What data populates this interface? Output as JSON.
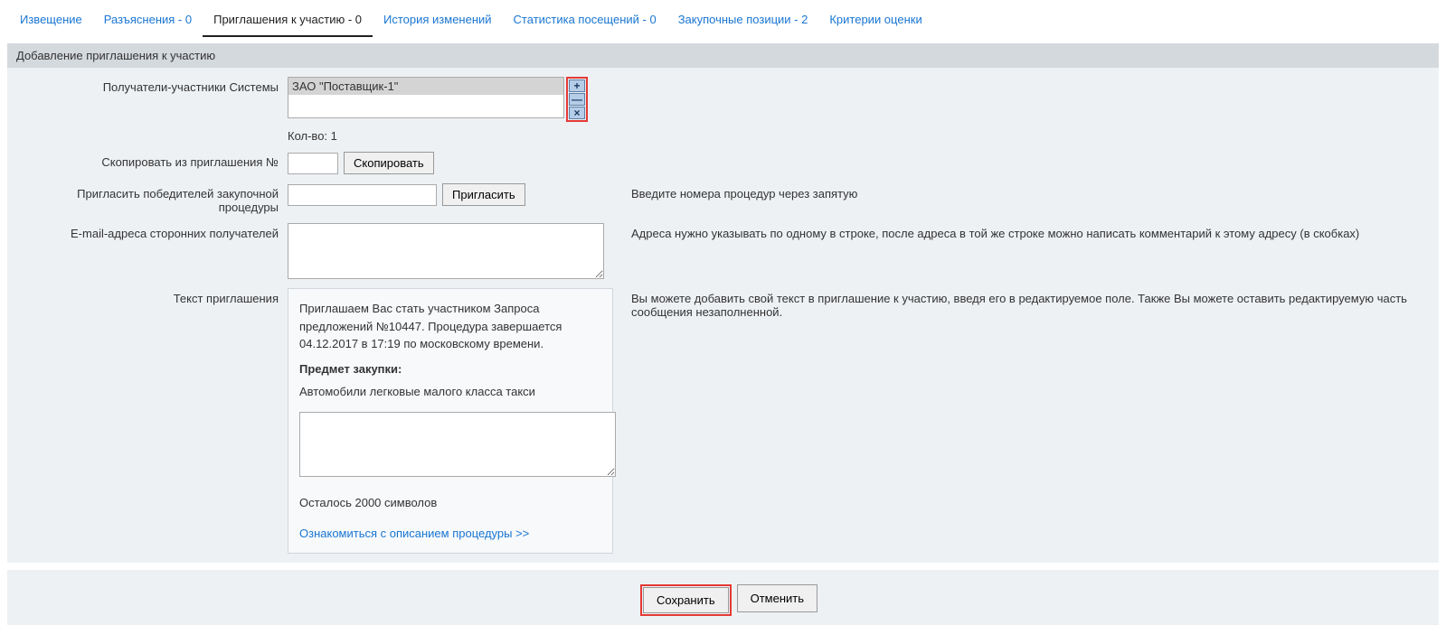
{
  "tabs": {
    "notice": "Извещение",
    "clarifications": "Разъяснения - 0",
    "invitations": "Приглашения к участию - 0",
    "history": "История изменений",
    "stats": "Статистика посещений - 0",
    "positions": "Закупочные позиции - 2",
    "criteria": "Критерии оценки"
  },
  "panel": {
    "title": "Добавление приглашения к участию"
  },
  "labels": {
    "recipients": "Получатели-участники Системы",
    "copy_from": "Скопировать из приглашения №",
    "invite_winners": "Пригласить победителей закупочной процедуры",
    "email_recipients": "E-mail-адреса сторонних получателей",
    "invitation_text": "Текст приглашения"
  },
  "recipients": {
    "item1": "ЗАО \"Поставщик-1\"",
    "count_label": "Кол-во: 1"
  },
  "buttons": {
    "copy": "Скопировать",
    "invite": "Пригласить",
    "save": "Сохранить",
    "cancel": "Отменить"
  },
  "hints": {
    "procedure_numbers": "Введите номера процедур через запятую",
    "email_format": "Адреса нужно указывать по одному в строке, после адреса в той же строке можно написать комментарий к этому адресу (в скобках)",
    "text_hint": "Вы можете добавить свой текст в приглашение к участию, введя его в редактируемое поле. Также Вы можете оставить редактируемую часть сообщения незаполненной."
  },
  "invitation": {
    "body1": "Приглашаем Вас стать участником Запроса предложений №10447. Процедура завершается 04.12.2017 в 17:19 по московскому времени.",
    "subject_title": "Предмет закупки:",
    "subject_value": "Автомобили легковые малого класса такси",
    "chars_left": "Осталось 2000 символов",
    "desc_link": "Ознакомиться с описанием процедуры >>"
  },
  "icons": {
    "plus": "+",
    "minus": "—",
    "close": "×"
  }
}
